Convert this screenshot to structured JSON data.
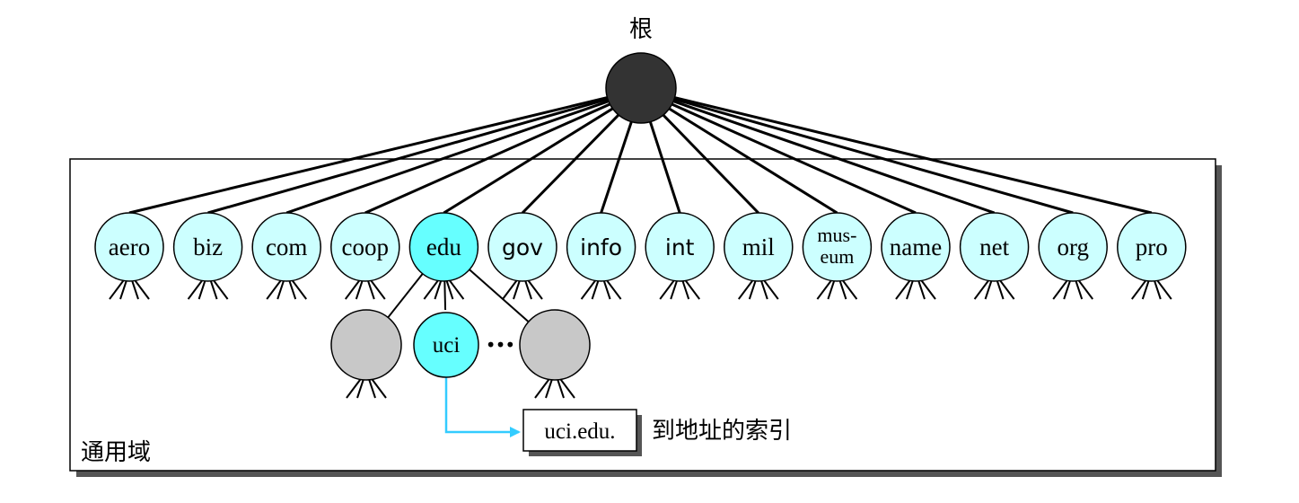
{
  "root": {
    "label": "根"
  },
  "domain_box": {
    "label": "通用域"
  },
  "tlds": [
    {
      "id": "aero",
      "label": "aero",
      "font": "serif"
    },
    {
      "id": "biz",
      "label": "biz",
      "font": "serif"
    },
    {
      "id": "com",
      "label": "com",
      "font": "serif"
    },
    {
      "id": "coop",
      "label": "coop",
      "font": "serif"
    },
    {
      "id": "edu",
      "label": "edu",
      "font": "serif",
      "highlight": true
    },
    {
      "id": "gov",
      "label": "gov",
      "font": "sans"
    },
    {
      "id": "info",
      "label": "info",
      "font": "sans"
    },
    {
      "id": "int",
      "label": "int",
      "font": "sans"
    },
    {
      "id": "mil",
      "label": "mil",
      "font": "serif"
    },
    {
      "id": "museum",
      "label": "mus-",
      "label2": "eum",
      "font": "serif"
    },
    {
      "id": "name",
      "label": "name",
      "font": "serif"
    },
    {
      "id": "net",
      "label": "net",
      "font": "serif"
    },
    {
      "id": "org",
      "label": "org",
      "font": "serif"
    },
    {
      "id": "pro",
      "label": "pro",
      "font": "serif"
    }
  ],
  "edu_children": [
    {
      "id": "other-left",
      "label": "",
      "gray": true
    },
    {
      "id": "uci",
      "label": "uci",
      "gray": false
    },
    {
      "id": "other-right",
      "label": "",
      "gray": true
    }
  ],
  "ellipsis": "•••",
  "index_entry": {
    "box_label": "uci.edu.",
    "caption": "到地址的索引"
  },
  "colors": {
    "root_fill": "#333333",
    "node_fill": "#ccffff",
    "highlight_fill": "#66ffff",
    "gray_fill": "#c8c8c8",
    "arrow": "#33ccff",
    "stroke": "#000000"
  }
}
